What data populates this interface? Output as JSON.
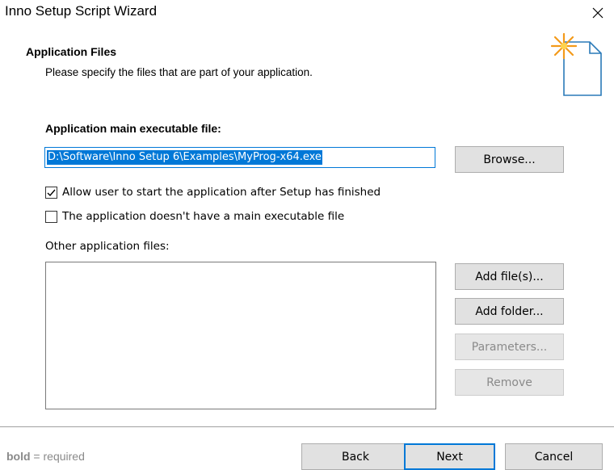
{
  "window": {
    "title": "Inno Setup Script Wizard",
    "close_icon": "close-icon"
  },
  "header": {
    "title": "Application Files",
    "description": "Please specify the files that are part of your application.",
    "icon": "wizard-document-icon"
  },
  "main_exe": {
    "label": "Application main executable file:",
    "value": "D:\\Software\\Inno Setup 6\\Examples\\MyProg-x64.exe",
    "browse_label": "Browse..."
  },
  "options": {
    "allow_start": {
      "label": "Allow user to start the application after Setup has finished",
      "checked": true
    },
    "no_main_exe": {
      "label": "The application doesn't have a main executable file",
      "checked": false
    }
  },
  "other_files": {
    "label": "Other application files:",
    "add_files_label": "Add file(s)...",
    "add_folder_label": "Add folder...",
    "parameters_label": "Parameters...",
    "remove_label": "Remove"
  },
  "footer": {
    "legend_bold": "bold",
    "legend_rest": " = required",
    "back_label": "Back",
    "next_label": "Next",
    "cancel_label": "Cancel"
  },
  "colors": {
    "accent": "#0078d7",
    "button_face": "#e1e1e1",
    "disabled_text": "#8a8a8a"
  }
}
